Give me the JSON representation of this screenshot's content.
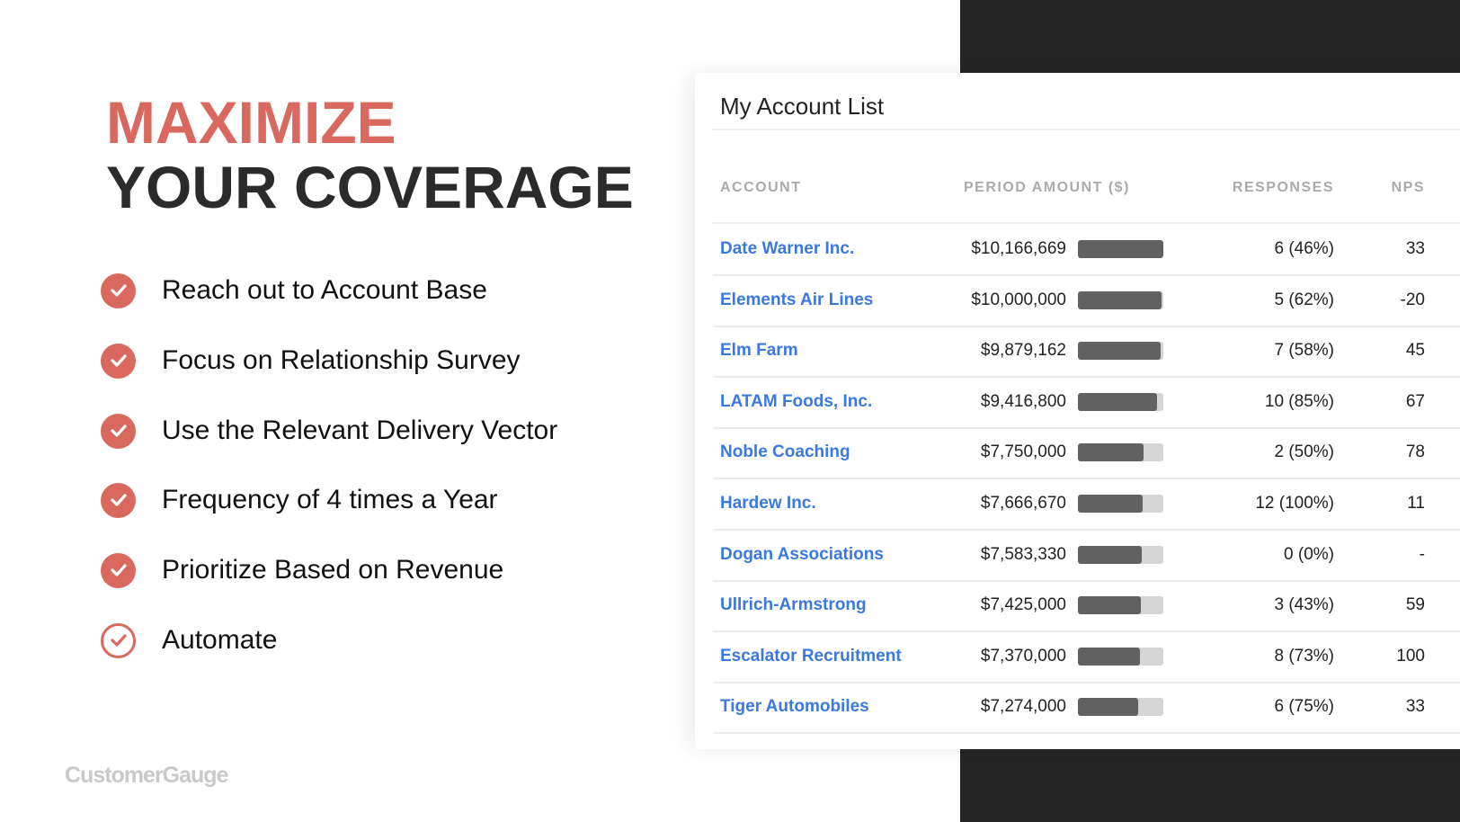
{
  "headline": {
    "line1": "MAXIMIZE",
    "line2": "YOUR COVERAGE"
  },
  "colors": {
    "accent": "#d9695f",
    "link": "#3b78e0",
    "bar": "#616161",
    "dark": "#252525"
  },
  "bullets": [
    {
      "text": "Reach out to Account Base",
      "icon": "check-circle-filled"
    },
    {
      "text": "Focus on Relationship Survey",
      "icon": "check-circle-filled"
    },
    {
      "text": "Use the Relevant Delivery Vector",
      "icon": "check-circle-filled"
    },
    {
      "text": "Frequency of 4 times a Year",
      "icon": "check-circle-filled"
    },
    {
      "text": "Prioritize Based on Revenue",
      "icon": "check-circle-filled"
    },
    {
      "text": "Automate",
      "icon": "check-circle-outline"
    }
  ],
  "logo": "CustomerGauge",
  "panel": {
    "title": "My Account List",
    "columns": [
      "ACCOUNT",
      "PERIOD AMOUNT ($)",
      "RESPONSES",
      "NPS"
    ],
    "rows": [
      {
        "account": "Date Warner Inc.",
        "amount": "$10,166,669",
        "fill": 1.0,
        "responses": "6 (46%)",
        "nps": "33"
      },
      {
        "account": "Elements Air Lines",
        "amount": "$10,000,000",
        "fill": 0.98,
        "responses": "5 (62%)",
        "nps": "-20"
      },
      {
        "account": "Elm Farm",
        "amount": "$9,879,162",
        "fill": 0.97,
        "responses": "7 (58%)",
        "nps": "45"
      },
      {
        "account": "LATAM Foods, Inc.",
        "amount": "$9,416,800",
        "fill": 0.93,
        "responses": "10 (85%)",
        "nps": "67"
      },
      {
        "account": "Noble Coaching",
        "amount": "$7,750,000",
        "fill": 0.77,
        "responses": "2 (50%)",
        "nps": "78"
      },
      {
        "account": "Hardew Inc.",
        "amount": "$7,666,670",
        "fill": 0.76,
        "responses": "12 (100%)",
        "nps": "11"
      },
      {
        "account": "Dogan Associations",
        "amount": "$7,583,330",
        "fill": 0.75,
        "responses": "0 (0%)",
        "nps": "-"
      },
      {
        "account": "Ullrich-Armstrong",
        "amount": "$7,425,000",
        "fill": 0.74,
        "responses": "3 (43%)",
        "nps": "59"
      },
      {
        "account": "Escalator Recruitment",
        "amount": "$7,370,000",
        "fill": 0.73,
        "responses": "8 (73%)",
        "nps": "100"
      },
      {
        "account": "Tiger Automobiles",
        "amount": "$7,274,000",
        "fill": 0.71,
        "responses": "6 (75%)",
        "nps": "33"
      }
    ]
  }
}
